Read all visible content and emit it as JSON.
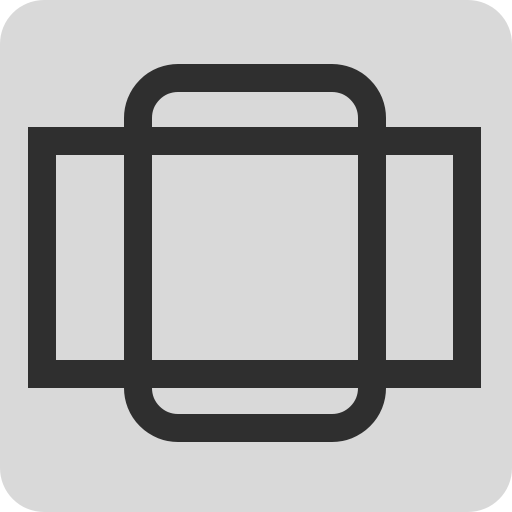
{
  "icon": {
    "name": "screen-rotation-icon",
    "background_color": "#d9d9d9",
    "stroke_color": "#2f2f2f"
  }
}
